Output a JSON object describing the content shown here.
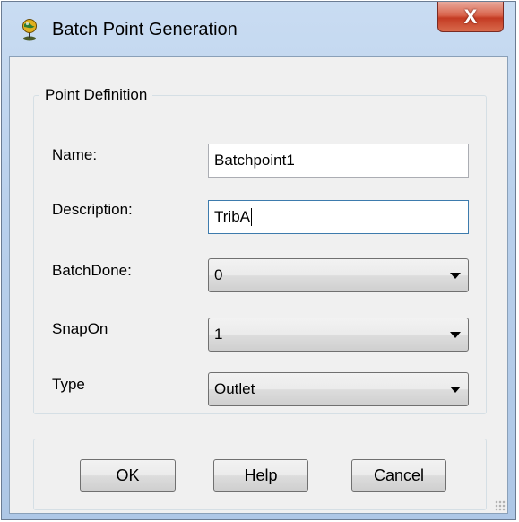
{
  "window": {
    "title": "Batch Point Generation",
    "close_label": "X"
  },
  "group": {
    "legend": "Point Definition"
  },
  "fields": {
    "name": {
      "label": "Name:",
      "value": "Batchpoint1"
    },
    "description": {
      "label": "Description:",
      "value": "TribA"
    },
    "batchdone": {
      "label": "BatchDone:",
      "value": "0"
    },
    "snapon": {
      "label": "SnapOn",
      "value": "1"
    },
    "type": {
      "label": "Type",
      "value": "Outlet"
    }
  },
  "buttons": {
    "ok": "OK",
    "help": "Help",
    "cancel": "Cancel"
  }
}
